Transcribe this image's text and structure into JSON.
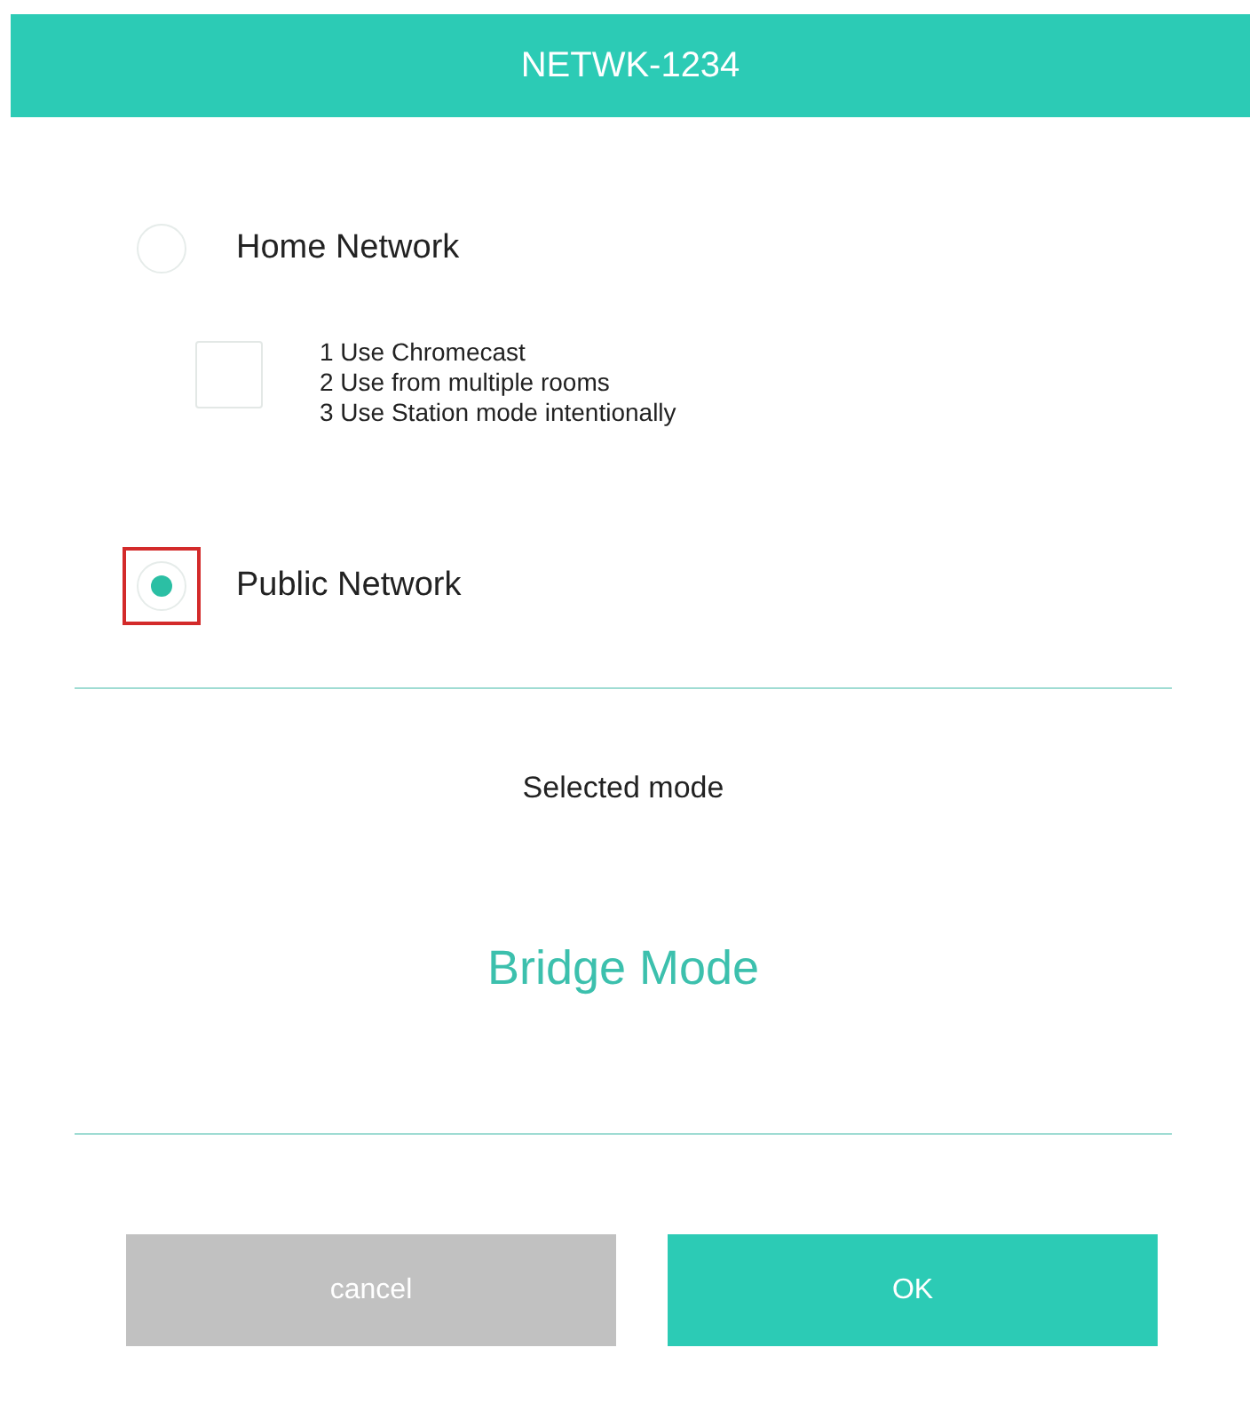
{
  "window": {
    "title": "NETWK-1234"
  },
  "options": [
    {
      "kind": "radio",
      "label": "Home Network",
      "selected": false,
      "highlighted": false
    },
    {
      "kind": "checkbox",
      "checked": false,
      "lines": [
        "1 Use Chromecast",
        "2 Use from multiple rooms",
        "3 Use Station mode intentionally"
      ]
    },
    {
      "kind": "radio",
      "label": "Public Network",
      "selected": true,
      "highlighted": true
    }
  ],
  "mode": {
    "caption": "Selected mode",
    "value": "Bridge Mode"
  },
  "buttons": [
    {
      "label": "cancel",
      "kind": "secondary"
    },
    {
      "label": "OK",
      "kind": "primary"
    }
  ]
}
